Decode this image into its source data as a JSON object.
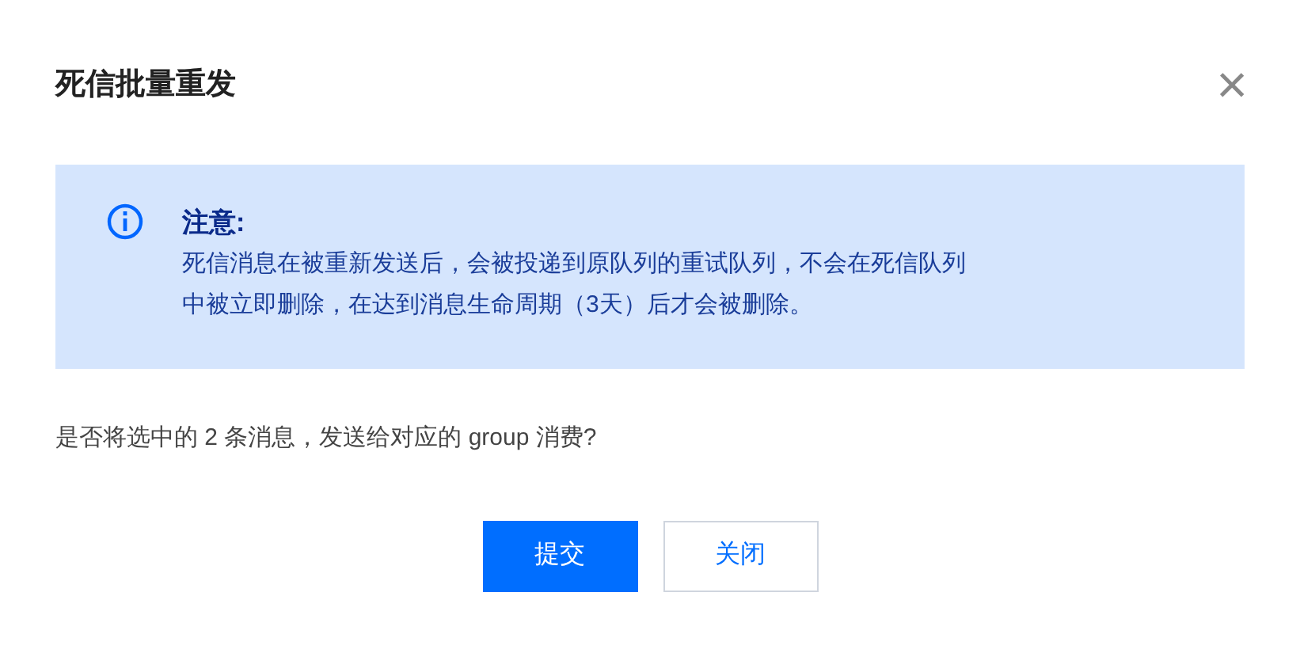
{
  "dialog": {
    "title": "死信批量重发",
    "close": "×"
  },
  "notice": {
    "heading": "注意:",
    "lines": [
      "死信消息在被重新发送后，会被投递到原队列的重试队列，不会在死信队列",
      "中被立即删除，在达到消息生命周期（3天）后才会被删除。"
    ]
  },
  "question": "是否将选中的 2 条消息，发送给对应的 group 消费?",
  "buttons": [
    {
      "label": "提交",
      "kind": "primary"
    },
    {
      "label": "关闭",
      "kind": "secondary"
    }
  ]
}
